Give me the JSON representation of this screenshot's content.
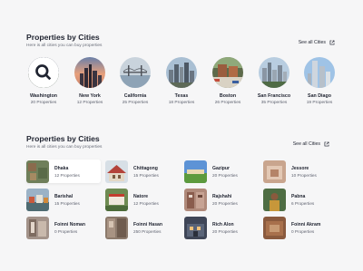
{
  "top_section": {
    "title": "Properties by Cities",
    "subtitle": "Here is all cities you can buy properties",
    "see_all": "See all Cities",
    "cities": [
      {
        "name": "Washington",
        "count": "20 Properties",
        "highlighted": true
      },
      {
        "name": "New York",
        "count": "12 Properties"
      },
      {
        "name": "California",
        "count": "25 Properties"
      },
      {
        "name": "Texas",
        "count": "18 Properties"
      },
      {
        "name": "Boston",
        "count": "26 Properties"
      },
      {
        "name": "San Francisco",
        "count": "35 Properties"
      },
      {
        "name": "San Diago",
        "count": "19 Properties"
      }
    ]
  },
  "bottom_section": {
    "title": "Properties by Cities",
    "subtitle": "Here is all cities you can buy properties",
    "see_all": "See all Cities",
    "cities": [
      {
        "name": "Dhaka",
        "count": "12 Properties",
        "active": true
      },
      {
        "name": "Chittagong",
        "count": "15 Properties"
      },
      {
        "name": "Gazipur",
        "count": "20 Properties"
      },
      {
        "name": "Jessore",
        "count": "10 Properties"
      },
      {
        "name": "Barishal",
        "count": "15 Properties"
      },
      {
        "name": "Natore",
        "count": "12 Properties"
      },
      {
        "name": "Rajshahi",
        "count": "20 Properties"
      },
      {
        "name": "Pabna",
        "count": "6 Properties"
      },
      {
        "name": "Foinni Noman",
        "count": "0 Properties"
      },
      {
        "name": "Foinni Hasan",
        "count": "250 Properties"
      },
      {
        "name": "Rich Alon",
        "count": "20 Properties"
      },
      {
        "name": "Foinni Akram",
        "count": "0 Properties"
      }
    ]
  },
  "icons": {
    "see_all": "external-link-icon",
    "hover_overlay": "search-icon"
  },
  "colors": {
    "background": "#f6f6f7",
    "text_primary": "#1f2330",
    "text_secondary": "#6b6f7b"
  }
}
